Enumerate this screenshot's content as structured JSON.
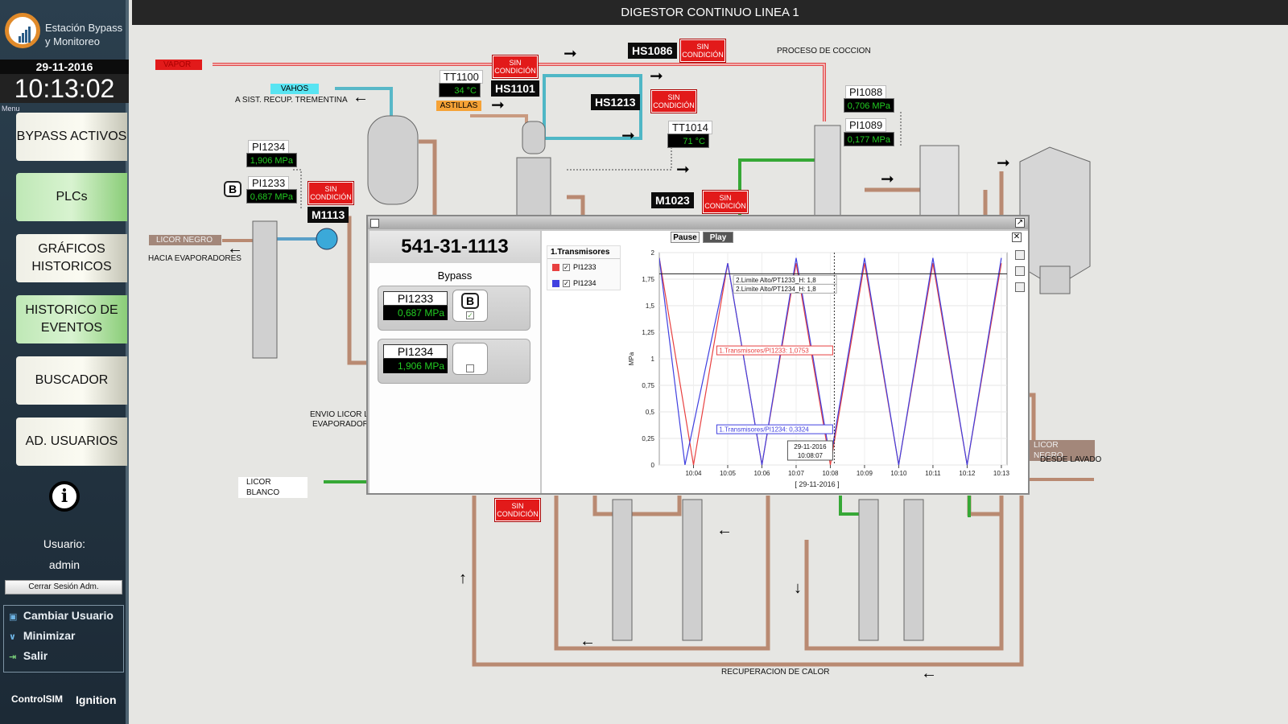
{
  "app": {
    "title": "Estación Bypass y Monitoreo",
    "date": "29-11-2016",
    "time": "10:13:02",
    "menu_label": "Menu",
    "screen_title": "DIGESTOR CONTINUO LINEA 1"
  },
  "nav": [
    {
      "label": "BYPASS ACTIVOS",
      "active": false
    },
    {
      "label": "PLCs",
      "active": true
    },
    {
      "label": "GRÁFICOS HISTORICOS",
      "active": false
    },
    {
      "label": "HISTORICO DE EVENTOS",
      "active": true
    },
    {
      "label": "BUSCADOR",
      "active": false
    },
    {
      "label": "AD. USUARIOS",
      "active": false
    }
  ],
  "user": {
    "label": "Usuario:",
    "name": "admin",
    "logout": "Cerrar Sesión Adm."
  },
  "side_menu": [
    {
      "label": "Cambiar Usuario",
      "icon": "monitor-icon"
    },
    {
      "label": "Minimizar",
      "icon": "chevron-down-icon"
    },
    {
      "label": "Salir",
      "icon": "exit-icon"
    }
  ],
  "brands": {
    "left": "ControlSIM",
    "right": "Ignition"
  },
  "process": {
    "streams": {
      "vapor": "VAPOR",
      "vahos": "VAHOS",
      "astillas": "ASTILLAS",
      "licor_negro_left": "LICOR NEGRO",
      "licor_negro_right": "LICOR NEGRO",
      "licor_blanco": "LICOR BLANCO"
    },
    "labels": {
      "recup_trementina": "A SIST. RECUP. TREMENTINA",
      "proceso_coccion": "PROCESO DE COCCION",
      "hacia_evaporadores": "HACIA EVAPORADORES",
      "envio_licor": "ENVIO LICOR L",
      "evaporador": "EVAPORADOR",
      "desde_lavado": "DESDE LAVADO",
      "recuperacion_calor": "RECUPERACION DE CALOR"
    },
    "tags": {
      "tt1100": {
        "name": "TT1100",
        "value": "34 °C"
      },
      "tt1014": {
        "name": "TT1014",
        "value": "71 °C"
      },
      "pi1234": {
        "name": "PI1234",
        "value": "1,906 MPa"
      },
      "pi1233": {
        "name": "PI1233",
        "value": "0,687 MPa"
      },
      "pi1088": {
        "name": "PI1088",
        "value": "0,706 MPa"
      },
      "pi1089": {
        "name": "PI1089",
        "value": "0,177 MPa"
      }
    },
    "devices": {
      "hs1086": "HS1086",
      "hs1101": "HS1101",
      "hs1213": "HS1213",
      "m1113": "M1113",
      "m1023": "M1023"
    },
    "sin_condicion": "SIN CONDICIÓN",
    "b_badge": "B"
  },
  "popup": {
    "id": "541-31-1113",
    "bypass_label": "Bypass",
    "rows": [
      {
        "name": "PI1233",
        "value": "0,687 MPa",
        "checked": true,
        "has_b": true
      },
      {
        "name": "PI1234",
        "value": "1,906 MPa",
        "checked": false,
        "has_b": false
      }
    ],
    "pause": "Pause",
    "play": "Play",
    "legend_title": "1.Transmisores",
    "legend": [
      {
        "name": "PI1233",
        "color": "#e84040"
      },
      {
        "name": "PI1234",
        "color": "#4040e0"
      }
    ]
  },
  "chart_data": {
    "type": "line",
    "ylabel": "MPa",
    "xlabel": "[ 29-11-2016 ]",
    "ylim": [
      0,
      2
    ],
    "yticks": [
      "0",
      "0,25",
      "0,5",
      "0,75",
      "1",
      "1,25",
      "1,5",
      "1,75",
      "2"
    ],
    "xticks": [
      "10:04",
      "10:05",
      "10:06",
      "10:07",
      "10:08",
      "10:09",
      "10:10",
      "10:11",
      "10:12",
      "10:13"
    ],
    "limit_line": 1.8,
    "limit_labels": [
      "2.Limite Alto/PT1233_H: 1,8",
      "2.Limite Alto/PT1234_H: 1,8"
    ],
    "cursor_time": "10:08",
    "cursor_label": [
      "29-11-2016",
      "10:08:07"
    ],
    "cursor_values": [
      "1.Transmisores/PI1233: 1,0753",
      "1.Transmisores/PI1234: 0,3324"
    ],
    "series": [
      {
        "name": "PI1233",
        "color": "#e84040",
        "x": [
          "10:03",
          "10:04",
          "10:05",
          "10:06",
          "10:07",
          "10:08",
          "10:09",
          "10:10",
          "10:11",
          "10:12",
          "10:13"
        ],
        "values": [
          1.95,
          0.0,
          1.9,
          0.0,
          1.9,
          0.0,
          1.9,
          0.0,
          1.9,
          0.0,
          1.9
        ]
      },
      {
        "name": "PI1234",
        "color": "#4040e0",
        "x": [
          "10:03",
          "10:03:45",
          "10:05",
          "10:06",
          "10:07",
          "10:08",
          "10:09",
          "10:10",
          "10:11",
          "10:12",
          "10:13"
        ],
        "values": [
          1.95,
          0.0,
          1.9,
          0.0,
          1.95,
          0.05,
          1.95,
          0.0,
          1.95,
          0.0,
          1.95
        ]
      }
    ]
  }
}
